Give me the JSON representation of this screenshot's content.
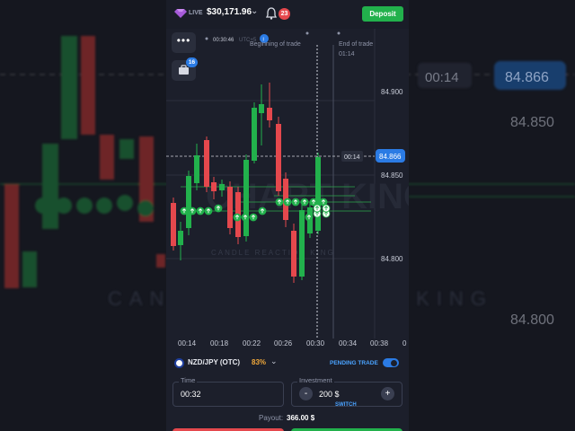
{
  "background": {
    "price_tag": "84.866",
    "time_tag": "00:14",
    "axis_labels": [
      "84.850",
      "84.800"
    ],
    "watermark": "CANDLE REACTION KING"
  },
  "header": {
    "live_label": "LIVE",
    "balance": "$30,171.96",
    "notifications_count": "23",
    "deposit_label": "Deposit"
  },
  "chart": {
    "timer_label": "00:30:46",
    "utc_label": "UTC+5",
    "info_badge": "i",
    "beginning_label": "Beginning of trade",
    "end_label": "End of trade",
    "end_time": "01:14",
    "price_levels": [
      "84.900",
      "84.850",
      "84.800"
    ],
    "current_price": "84.866",
    "countdown": "00:14",
    "time_labels": [
      "00:14",
      "00:18",
      "00:22",
      "00:26",
      "00:30",
      "00:34",
      "00:38",
      "0"
    ],
    "watermark_big": "CHART KING",
    "watermark_small": "CANDLE REACTION KING"
  },
  "side_buttons": {
    "menu_icon_text": "•••",
    "bag_badge": "16"
  },
  "asset": {
    "name": "NZD/JPY (OTC)",
    "payout_pct": "83%",
    "pending_label": "PENDING TRADE"
  },
  "form": {
    "time_label": "Time",
    "time_value": "00:32",
    "investment_label": "Investment",
    "investment_value": "200 $",
    "minus": "-",
    "plus": "+",
    "switch_label": "SWITCH",
    "payout_label": "Payout:",
    "payout_value": "366.00 $"
  },
  "colors": {
    "up": "#22b14c",
    "down": "#e5484d",
    "accent": "#2b7be4"
  }
}
